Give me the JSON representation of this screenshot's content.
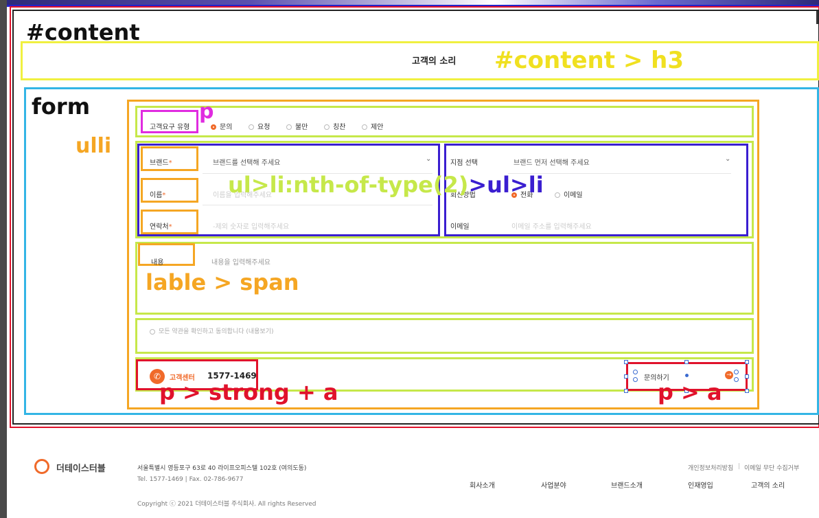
{
  "annotations": {
    "content": "#content",
    "h3": "#content > h3",
    "form": "form",
    "ulli": "ulli",
    "p": "p",
    "nth": "ul>li:nth-of-type(2)",
    "nth_child": ">ul>li",
    "label_span": "lable > span",
    "strong_a": "p > strong + a",
    "p_a": "p > a"
  },
  "page": {
    "title": "고객의 소리"
  },
  "form": {
    "type_label": "고객요구 유형",
    "types": [
      "문의",
      "요청",
      "불만",
      "칭찬",
      "제안"
    ],
    "brand_label": "브랜드",
    "brand_placeholder": "브랜드를 선택해 주세요",
    "branch_label": "지점 선택",
    "branch_placeholder": "브랜드 먼저 선택해 주세요",
    "name_label": "이름",
    "name_placeholder": "이름을 입력해주세요",
    "reply_label": "회신방법",
    "reply_options": [
      "전화",
      "이메일"
    ],
    "contact_label": "연락처",
    "contact_placeholder": "-제외 숫자로 입력해주세요",
    "email_label": "이메일",
    "email_placeholder": "이메일 주소를 입력해주세요",
    "content_label": "내용",
    "content_placeholder": "내용을 입력해주세요",
    "required_mark": "*",
    "agree_text": "모든 약관을 확인하고 동의합니다 (내용보기)",
    "cs_label": "고객센터",
    "cs_number": "1577-1469",
    "submit_label": "문의하기"
  },
  "footer": {
    "logo_text": "더테이스터블",
    "address": "서울특별시 영등포구 63로 40 라이프오피스텔 102호 (여의도동)",
    "tel": "Tel. 1577-1469",
    "fax": "Fax. 02-786-9677",
    "copyright": "Copyright ⓒ 2021 더테이스터블 주식회사. All rights Reserved",
    "policy_links": [
      "개인정보처리방침",
      "이메일 무단 수집거부"
    ],
    "nav": [
      "회사소개",
      "사업분야",
      "브랜드소개",
      "인재영입",
      "고객의 소리"
    ]
  },
  "colors": {
    "accent": "#f06a2a",
    "annot_yellow": "#f0f040",
    "annot_blue": "#33b5e5",
    "annot_orange": "#f5a623",
    "annot_lime": "#c6e84a",
    "annot_purple": "#3a1ed0",
    "annot_magenta": "#e02be0",
    "annot_red": "#e0122b"
  }
}
